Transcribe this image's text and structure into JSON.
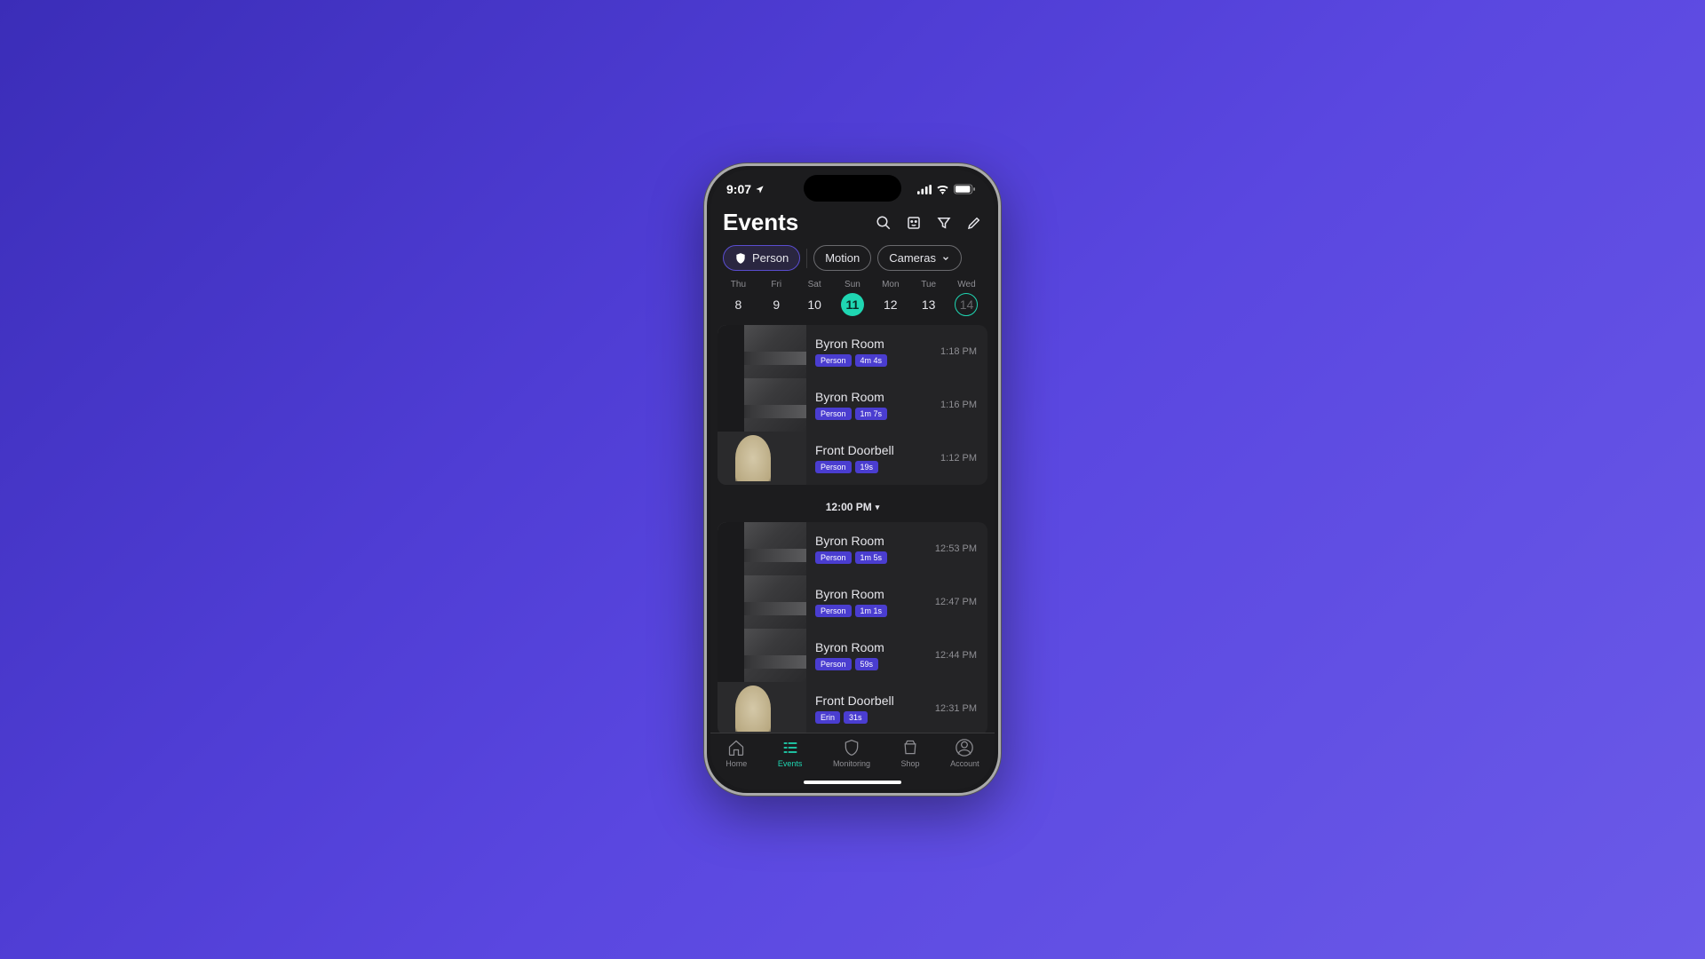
{
  "status": {
    "time": "9:07"
  },
  "header": {
    "title": "Events"
  },
  "filters": {
    "person": "Person",
    "motion": "Motion",
    "cameras": "Cameras"
  },
  "calendar": [
    {
      "dow": "Thu",
      "num": "8"
    },
    {
      "dow": "Fri",
      "num": "9"
    },
    {
      "dow": "Sat",
      "num": "10"
    },
    {
      "dow": "Sun",
      "num": "11",
      "selected": true
    },
    {
      "dow": "Mon",
      "num": "12"
    },
    {
      "dow": "Tue",
      "num": "13"
    },
    {
      "dow": "Wed",
      "num": "14",
      "today": true
    }
  ],
  "groups": [
    {
      "events": [
        {
          "camera": "Byron Room",
          "tags": [
            "Person",
            "4m 4s"
          ],
          "time": "1:18 PM",
          "kind": "byron"
        },
        {
          "camera": "Byron Room",
          "tags": [
            "Person",
            "1m 7s"
          ],
          "time": "1:16 PM",
          "kind": "byron"
        },
        {
          "camera": "Front Doorbell",
          "tags": [
            "Person",
            "19s"
          ],
          "time": "1:12 PM",
          "kind": "doorbell"
        }
      ]
    },
    {
      "divider": "12:00 PM",
      "events": [
        {
          "camera": "Byron Room",
          "tags": [
            "Person",
            "1m 5s"
          ],
          "time": "12:53 PM",
          "kind": "byron"
        },
        {
          "camera": "Byron Room",
          "tags": [
            "Person",
            "1m 1s"
          ],
          "time": "12:47 PM",
          "kind": "byron"
        },
        {
          "camera": "Byron Room",
          "tags": [
            "Person",
            "59s"
          ],
          "time": "12:44 PM",
          "kind": "byron"
        },
        {
          "camera": "Front Doorbell",
          "tags": [
            "Erin",
            "31s"
          ],
          "time": "12:31 PM",
          "kind": "doorbell"
        }
      ]
    }
  ],
  "tabs": [
    {
      "label": "Home"
    },
    {
      "label": "Events",
      "active": true
    },
    {
      "label": "Monitoring"
    },
    {
      "label": "Shop"
    },
    {
      "label": "Account"
    }
  ]
}
